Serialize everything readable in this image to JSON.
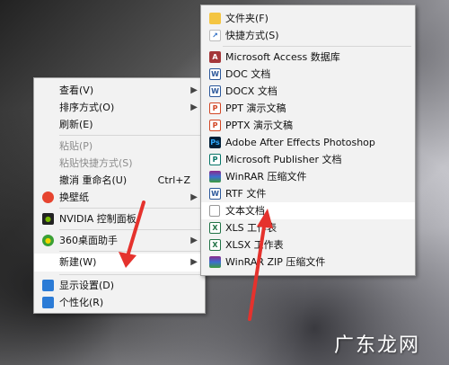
{
  "context_menu": {
    "items": [
      {
        "label": "查看(V)"
      },
      {
        "label": "排序方式(O)"
      },
      {
        "label": "刷新(E)"
      },
      {
        "label": "粘贴(P)"
      },
      {
        "label": "粘贴快捷方式(S)"
      },
      {
        "label": "撤消 重命名(U)",
        "shortcut": "Ctrl+Z"
      },
      {
        "label": "换壁纸"
      },
      {
        "label": "NVIDIA 控制面板"
      },
      {
        "label": "360桌面助手"
      },
      {
        "label": "新建(W)"
      },
      {
        "label": "显示设置(D)"
      },
      {
        "label": "个性化(R)"
      }
    ]
  },
  "new_submenu": {
    "items": [
      {
        "label": "文件夹(F)"
      },
      {
        "label": "快捷方式(S)"
      },
      {
        "label": "Microsoft Access 数据库"
      },
      {
        "label": "DOC 文档"
      },
      {
        "label": "DOCX 文档"
      },
      {
        "label": "PPT 演示文稿"
      },
      {
        "label": "PPTX 演示文稿"
      },
      {
        "label": "Adobe After Effects Photoshop"
      },
      {
        "label": "Microsoft Publisher 文档"
      },
      {
        "label": "WinRAR 压缩文件"
      },
      {
        "label": "RTF 文件"
      },
      {
        "label": "文本文档"
      },
      {
        "label": "XLS 工作表"
      },
      {
        "label": "XLSX 工作表"
      },
      {
        "label": "WinRAR ZIP 压缩文件"
      }
    ]
  },
  "watermark": "广东龙网",
  "colors": {
    "menu_bg": "#f2f2f2",
    "highlight": "#ffffff",
    "arrow_annotation": "#e5322d"
  }
}
